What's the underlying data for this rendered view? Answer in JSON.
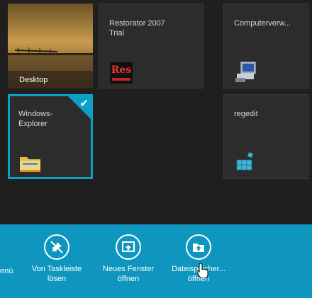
{
  "tiles": {
    "desktop": {
      "label": "Desktop"
    },
    "restorator": {
      "label": "Restorator 2007\nTrial",
      "icon_text": "Res"
    },
    "computer": {
      "label": "Computerverw..."
    },
    "explorer": {
      "label": "Windows-\nExplorer",
      "selected": true
    },
    "regedit": {
      "label": "regedit"
    }
  },
  "appbar": {
    "partial_label": "enü",
    "commands": [
      {
        "label": "Von Taskleiste\nlösen",
        "icon": "unpin-icon"
      },
      {
        "label": "Neues Fenster\nöffnen",
        "icon": "new-window-icon"
      },
      {
        "label": "Dateispeicher...\nöffnen",
        "icon": "open-file-location-icon"
      }
    ]
  },
  "colors": {
    "accent": "#0aa0c8",
    "appbar": "#0f96bf",
    "background": "#1f1f1f"
  }
}
